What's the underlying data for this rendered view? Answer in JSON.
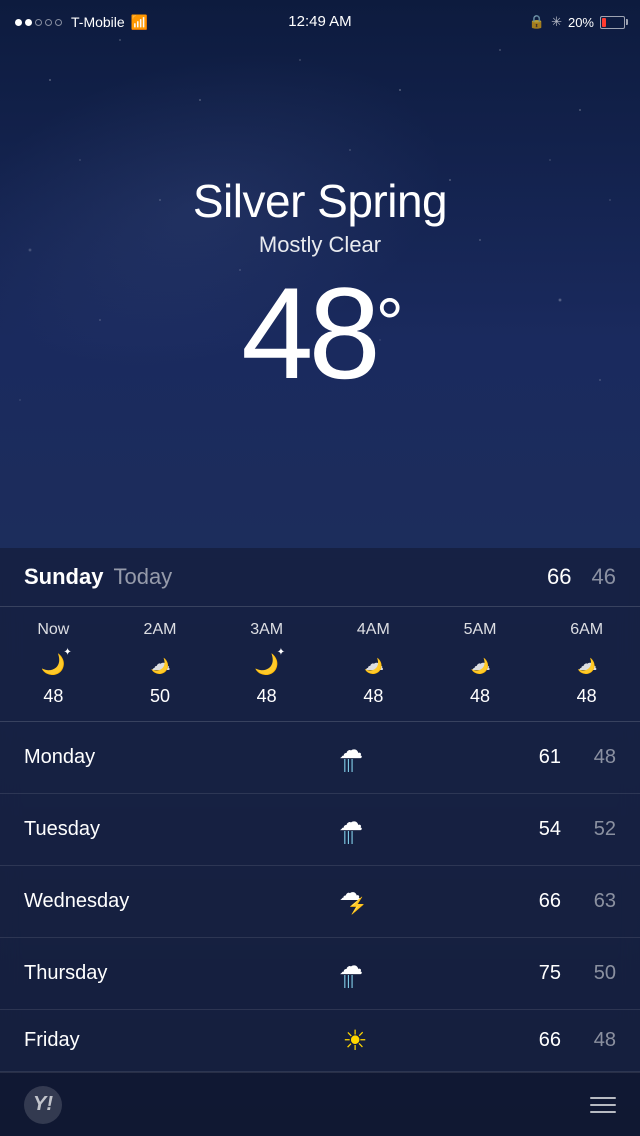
{
  "statusBar": {
    "carrier": "T-Mobile",
    "time": "12:49 AM",
    "battery_pct": "20%",
    "signal_dots": [
      true,
      true,
      false,
      false,
      false
    ]
  },
  "weather": {
    "city": "Silver Spring",
    "condition": "Mostly Clear",
    "temperature": "48",
    "degree_symbol": "°"
  },
  "today": {
    "day": "Sunday",
    "label": "Today",
    "high": "66",
    "low": "46"
  },
  "hourly": [
    {
      "label": "Now",
      "icon": "🌙",
      "temp": "48"
    },
    {
      "label": "2AM",
      "icon": "☁🌙",
      "temp": "50"
    },
    {
      "label": "3AM",
      "icon": "🌙",
      "temp": "48"
    },
    {
      "label": "4AM",
      "icon": "☁🌙",
      "temp": "48"
    },
    {
      "label": "5AM",
      "icon": "☁🌙",
      "temp": "48"
    },
    {
      "label": "6AM",
      "icon": "☁🌙",
      "temp": "48"
    }
  ],
  "forecast": [
    {
      "day": "Monday",
      "icon_type": "rain",
      "high": "61",
      "low": "48"
    },
    {
      "day": "Tuesday",
      "icon_type": "rain",
      "high": "54",
      "low": "52"
    },
    {
      "day": "Wednesday",
      "icon_type": "thunder",
      "high": "66",
      "low": "63"
    },
    {
      "day": "Thursday",
      "icon_type": "rain",
      "high": "75",
      "low": "50"
    },
    {
      "day": "Friday",
      "icon_type": "sunny",
      "high": "66",
      "low": "48"
    }
  ],
  "toolbar": {
    "yahoo_label": "Y!",
    "menu_label": "≡"
  }
}
